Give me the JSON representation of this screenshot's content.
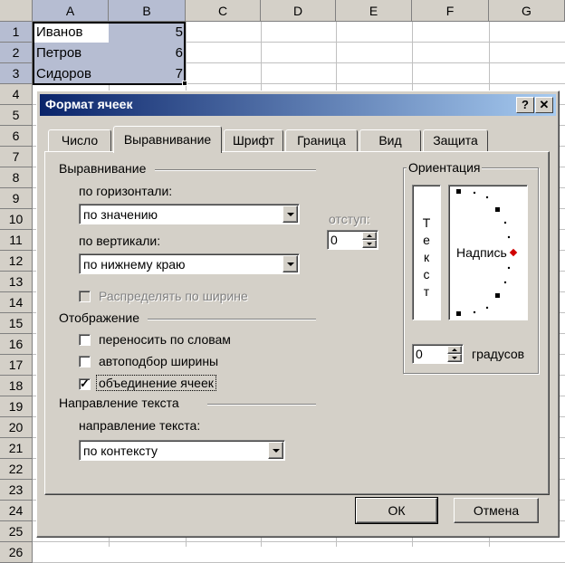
{
  "sheet": {
    "columns": [
      "A",
      "B",
      "C",
      "D",
      "E",
      "F",
      "G"
    ],
    "rows": [
      "1",
      "2",
      "3",
      "4",
      "5",
      "6",
      "7",
      "8",
      "9",
      "10",
      "11",
      "12",
      "13",
      "14",
      "15",
      "16",
      "17",
      "18",
      "19",
      "20",
      "21",
      "22",
      "23",
      "24",
      "25",
      "26"
    ],
    "cells": [
      {
        "name": "Иванов",
        "value": "5"
      },
      {
        "name": "Петров",
        "value": "6"
      },
      {
        "name": "Сидоров",
        "value": "7"
      }
    ]
  },
  "dialog": {
    "title": "Формат ячеек",
    "help_label": "?",
    "close_label": "✕",
    "tabs": [
      "Число",
      "Выравнивание",
      "Шрифт",
      "Граница",
      "Вид",
      "Защита"
    ],
    "active_tab": "Выравнивание",
    "alignment": {
      "section": "Выравнивание",
      "horizontal_label": "по горизонтали:",
      "horizontal_value": "по значению",
      "vertical_label": "по вертикали:",
      "vertical_value": "по нижнему краю",
      "indent_label": "отступ:",
      "indent_value": "0",
      "distributed_label": "Распределять по ширине"
    },
    "display": {
      "section": "Отображение",
      "wrap_label": "переносить по словам",
      "shrink_label": "автоподбор ширины",
      "merge_label": "объединение ячеек",
      "merge_checked": true
    },
    "direction": {
      "section": "Направление текста",
      "label": "направление текста:",
      "value": "по контексту"
    },
    "orientation": {
      "section": "Ориентация",
      "vertical_text": [
        "Т",
        "е",
        "к",
        "с",
        "т"
      ],
      "dial_label": "Надпись",
      "degrees_value": "0",
      "degrees_label": "градусов"
    },
    "ok_label": "ОК",
    "cancel_label": "Отмена"
  }
}
